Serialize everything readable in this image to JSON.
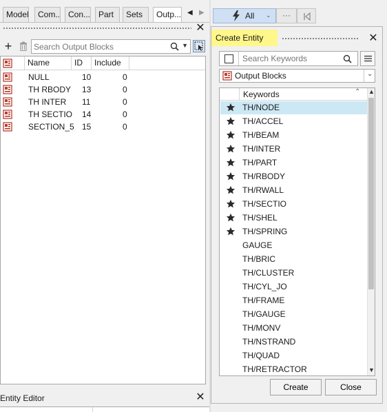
{
  "tabs": [
    {
      "label": "Model"
    },
    {
      "label": "Com..."
    },
    {
      "label": "Con..."
    },
    {
      "label": "Part"
    },
    {
      "label": "Sets"
    },
    {
      "label": "Outp..."
    }
  ],
  "output_panel": {
    "search_placeholder": "Search Output Blocks",
    "columns": [
      "Name",
      "ID",
      "Include"
    ],
    "rows": [
      {
        "name": "NULL",
        "id": "10",
        "include": "0"
      },
      {
        "name": "TH RBODY",
        "id": "13",
        "include": "0"
      },
      {
        "name": "TH INTER",
        "id": "11",
        "include": "0"
      },
      {
        "name": "TH SECTIO",
        "id": "14",
        "include": "0"
      },
      {
        "name": "SECTION_5",
        "id": "15",
        "include": "0"
      }
    ]
  },
  "entity_editor": {
    "title": "Entity Editor"
  },
  "toolbar": {
    "filter_label": "All"
  },
  "create_entity": {
    "title": "Create Entity",
    "search_placeholder": "Search Keywords",
    "dropdown_value": "Output Blocks",
    "keywords_header": "Keywords",
    "keywords": [
      {
        "label": "TH/NODE",
        "starred": true,
        "selected": true
      },
      {
        "label": "TH/ACCEL",
        "starred": true
      },
      {
        "label": "TH/BEAM",
        "starred": true
      },
      {
        "label": "TH/INTER",
        "starred": true
      },
      {
        "label": "TH/PART",
        "starred": true
      },
      {
        "label": "TH/RBODY",
        "starred": true
      },
      {
        "label": "TH/RWALL",
        "starred": true
      },
      {
        "label": "TH/SECTIO",
        "starred": true
      },
      {
        "label": "TH/SHEL",
        "starred": true
      },
      {
        "label": "TH/SPRING",
        "starred": true
      },
      {
        "label": "GAUGE",
        "starred": false
      },
      {
        "label": "TH/BRIC",
        "starred": false
      },
      {
        "label": "TH/CLUSTER",
        "starred": false
      },
      {
        "label": "TH/CYL_JO",
        "starred": false
      },
      {
        "label": "TH/FRAME",
        "starred": false
      },
      {
        "label": "TH/GAUGE",
        "starred": false
      },
      {
        "label": "TH/MONV",
        "starred": false
      },
      {
        "label": "TH/NSTRAND",
        "starred": false
      },
      {
        "label": "TH/QUAD",
        "starred": false
      },
      {
        "label": "TH/RETRACTOR",
        "starred": false
      }
    ],
    "create_label": "Create",
    "close_label": "Close"
  },
  "colors": {
    "highlight": "#fff78a",
    "selection": "#cce8f4",
    "accent": "#d8e8f8"
  }
}
